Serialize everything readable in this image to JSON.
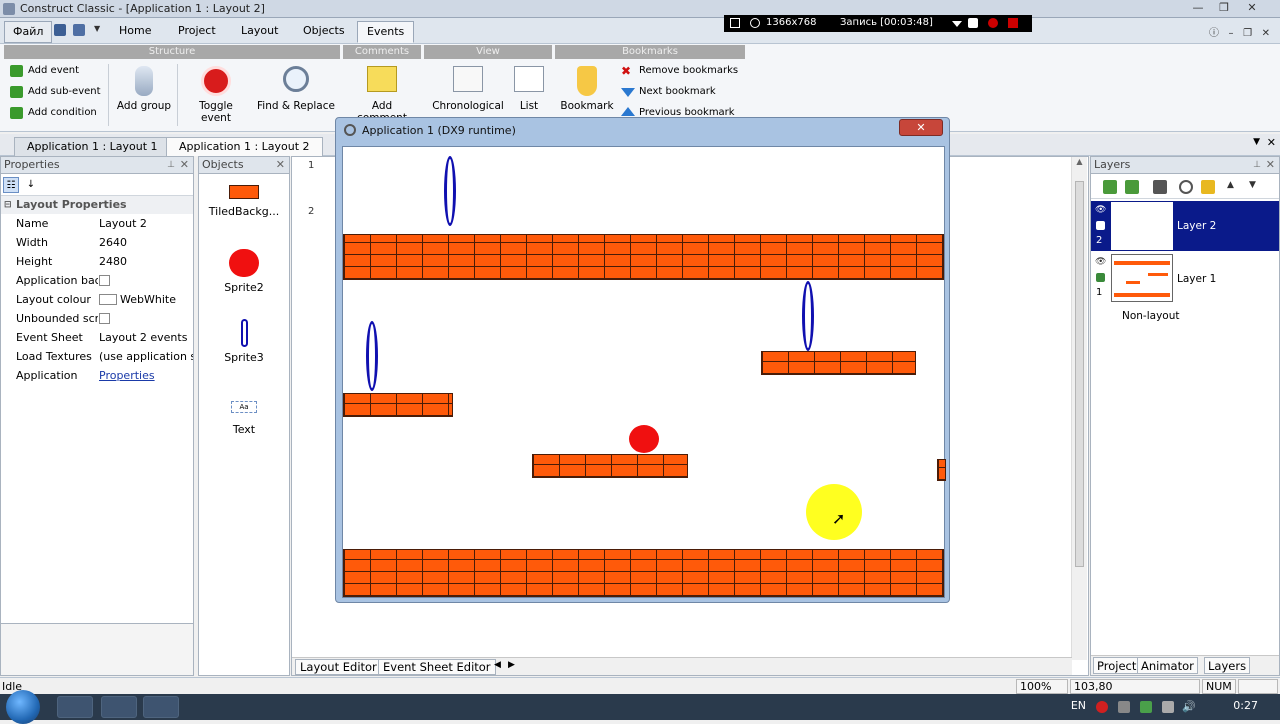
{
  "window": {
    "title": "Construct Classic - [Application 1 : Layout 2]",
    "controls": [
      "—",
      "❐",
      "✕"
    ]
  },
  "recorder": {
    "resolution": "1366x768",
    "status": "Запись [00:03:48]"
  },
  "ribbon": {
    "file_tab": "Файл",
    "tabs": [
      "Home",
      "Project",
      "Layout",
      "Objects",
      "Events"
    ],
    "active_tab": "Events",
    "groups": {
      "structure": "Structure",
      "comments": "Comments",
      "view": "View",
      "bookmarks": "Bookmarks"
    },
    "small_buttons": {
      "add_event": "Add event",
      "add_sub_event": "Add sub-event",
      "add_condition": "Add condition"
    },
    "big_buttons": {
      "add_group": "Add group",
      "toggle_event": "Toggle event",
      "find_replace": "Find & Replace",
      "add_comment": "Add comment",
      "chronological": "Chronological",
      "list": "List",
      "bookmark": "Bookmark"
    },
    "bookmark_buttons": {
      "remove": "Remove bookmarks",
      "next": "Next bookmark",
      "previous": "Previous bookmark"
    }
  },
  "doc_tabs": [
    "Application 1 : Layout 1",
    "Application 1 : Layout 2"
  ],
  "properties": {
    "header": "Properties",
    "section": "Layout Properties",
    "rows": [
      {
        "key": "Name",
        "value": "Layout 2"
      },
      {
        "key": "Width",
        "value": "2640"
      },
      {
        "key": "Height",
        "value": "2480"
      },
      {
        "key": "Application bac",
        "value": ""
      },
      {
        "key": "Layout colour",
        "value": "WebWhite"
      },
      {
        "key": "Unbounded scr",
        "value": ""
      },
      {
        "key": "Event Sheet",
        "value": "Layout 2 events"
      },
      {
        "key": "Load Textures",
        "value": "(use application se"
      },
      {
        "key": "Application",
        "value": "Properties"
      }
    ]
  },
  "objects": {
    "header": "Objects",
    "items": [
      "TiledBackg...",
      "Sprite2",
      "Sprite3",
      "Text"
    ]
  },
  "event_sheet": {
    "event_numbers": [
      "1",
      "2"
    ],
    "tabs": [
      "Layout Editor",
      "Event Sheet Editor"
    ]
  },
  "game_window": {
    "title": "Application 1 (DX9 runtime)"
  },
  "layers": {
    "header": "Layers",
    "items": [
      {
        "name": "Layer 2",
        "index": "2",
        "selected": true
      },
      {
        "name": "Layer 1",
        "index": "1",
        "selected": false
      }
    ],
    "non_layout": "Non-layout",
    "tabs": [
      "Project",
      "Animator",
      "Layers"
    ]
  },
  "status": {
    "text": "Idle",
    "zoom": "100%",
    "coords": "103,80",
    "num": "NUM"
  },
  "taskbar": {
    "lang": "EN",
    "time": "0:27"
  },
  "colors": {
    "brick": "#ff5a0a",
    "ring": "#1010b0",
    "ball": "#f01010",
    "highlight": "#ffff20",
    "selected_layer": "#0a1a8a"
  }
}
